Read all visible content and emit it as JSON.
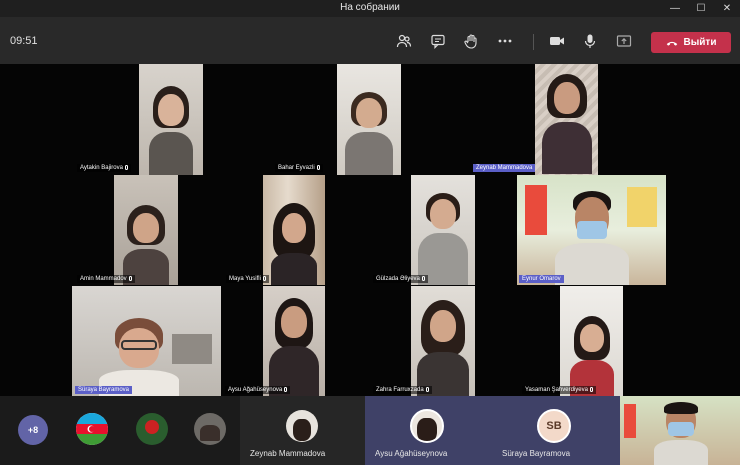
{
  "window": {
    "title": "На собрании"
  },
  "toolbar": {
    "time": "09:51",
    "leave_label": "Выйти"
  },
  "participants": [
    {
      "name": "Aytakin Bajirova"
    },
    {
      "name": "Bahar Eyvazli"
    },
    {
      "name": "Zeynab Mammadova"
    },
    {
      "name": "Amin Mammadov"
    },
    {
      "name": "Maya Yusifli"
    },
    {
      "name": "Gülzada Əliyeva"
    },
    {
      "name": "Eynur Omarov"
    },
    {
      "name": "Süraya Bayramova"
    },
    {
      "name": "Aysu Ağahüseynova"
    },
    {
      "name": "Zahra Farruxzada"
    },
    {
      "name": "Yasaman Şahverdiyeva"
    }
  ],
  "strip": {
    "overflow": "+8",
    "items": [
      {
        "name": "Zeynab Mammadova"
      },
      {
        "name": "Aysu Ağahüseynova"
      },
      {
        "name": "Süraya Bayramova",
        "initials": "SB"
      }
    ]
  },
  "colors": {
    "leave": "#c4314b",
    "accent": "#6264a7",
    "highlight": "#5b5fc7"
  }
}
